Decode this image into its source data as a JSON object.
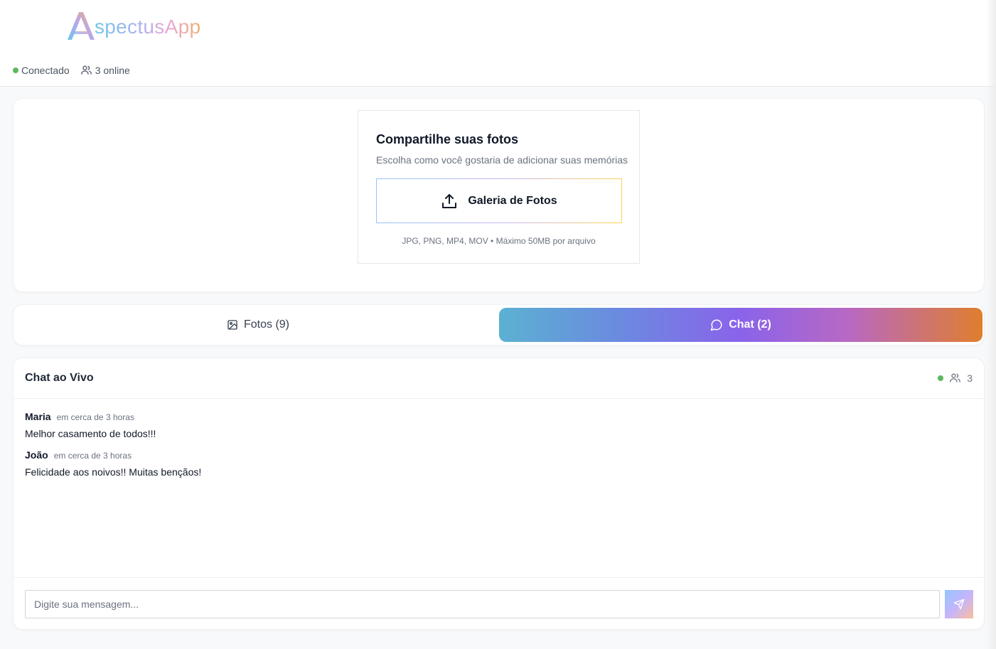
{
  "header": {
    "logo_text": "spectusApp",
    "logo_letter": "A",
    "status_connected": "Conectado",
    "online_count": "3 online",
    "status_color": "#5cb85c"
  },
  "upload": {
    "title": "Compartilhe suas fotos",
    "subtitle": "Escolha como você gostaria de adicionar suas memórias",
    "gallery_button": "Galeria de Fotos",
    "note": "JPG, PNG, MP4, MOV • Máximo 50MB por arquivo",
    "icon": "upload-icon"
  },
  "tabs": [
    {
      "label": "Fotos (9)",
      "icon": "image-icon",
      "active": false
    },
    {
      "label": "Chat (2)",
      "icon": "chat-bubble-icon",
      "active": true
    }
  ],
  "chat": {
    "title": "Chat ao Vivo",
    "online_count": "3",
    "messages": [
      {
        "author": "Maria",
        "time": "em cerca de 3 horas",
        "text": "Melhor casamento de todos!!!"
      },
      {
        "author": "João",
        "time": "em cerca de 3 horas",
        "text": "Felicidade aos noivos!! Muitas bençãos!"
      }
    ],
    "input_placeholder": "Digite sua mensagem...",
    "send_icon": "send-icon"
  }
}
